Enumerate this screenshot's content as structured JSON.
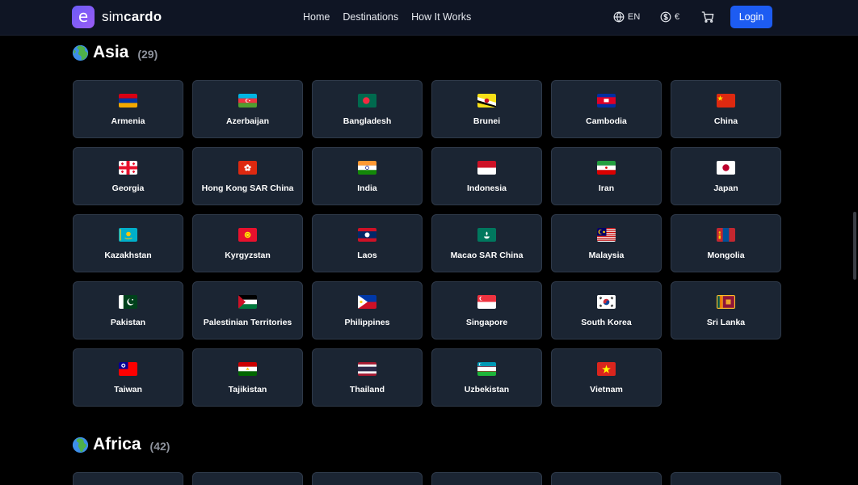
{
  "brand": {
    "logo_glyph": "e",
    "name_light": "sim",
    "name_bold": "cardo",
    "accent_color": "#7b5cf6"
  },
  "nav": {
    "items": [
      "Home",
      "Destinations",
      "How It Works"
    ]
  },
  "header": {
    "language": "EN",
    "currency": "€",
    "login_label": "Login",
    "login_color": "#1d5cf2"
  },
  "sections": [
    {
      "title": "Asia",
      "count": "(29)",
      "countries": [
        {
          "name": "Armenia",
          "flag": "am"
        },
        {
          "name": "Azerbaijan",
          "flag": "az"
        },
        {
          "name": "Bangladesh",
          "flag": "bd"
        },
        {
          "name": "Brunei",
          "flag": "bn"
        },
        {
          "name": "Cambodia",
          "flag": "kh"
        },
        {
          "name": "China",
          "flag": "cn"
        },
        {
          "name": "Georgia",
          "flag": "ge"
        },
        {
          "name": "Hong Kong SAR China",
          "flag": "hk"
        },
        {
          "name": "India",
          "flag": "in"
        },
        {
          "name": "Indonesia",
          "flag": "id"
        },
        {
          "name": "Iran",
          "flag": "ir"
        },
        {
          "name": "Japan",
          "flag": "jp"
        },
        {
          "name": "Kazakhstan",
          "flag": "kz"
        },
        {
          "name": "Kyrgyzstan",
          "flag": "kg"
        },
        {
          "name": "Laos",
          "flag": "la"
        },
        {
          "name": "Macao SAR China",
          "flag": "mo"
        },
        {
          "name": "Malaysia",
          "flag": "my"
        },
        {
          "name": "Mongolia",
          "flag": "mn"
        },
        {
          "name": "Pakistan",
          "flag": "pk"
        },
        {
          "name": "Palestinian Territories",
          "flag": "ps"
        },
        {
          "name": "Philippines",
          "flag": "ph"
        },
        {
          "name": "Singapore",
          "flag": "sg"
        },
        {
          "name": "South Korea",
          "flag": "kr"
        },
        {
          "name": "Sri Lanka",
          "flag": "lk"
        },
        {
          "name": "Taiwan",
          "flag": "tw"
        },
        {
          "name": "Tajikistan",
          "flag": "tj"
        },
        {
          "name": "Thailand",
          "flag": "th"
        },
        {
          "name": "Uzbekistan",
          "flag": "uz"
        },
        {
          "name": "Vietnam",
          "flag": "vn"
        }
      ]
    },
    {
      "title": "Africa",
      "count": "(42)",
      "countries": []
    }
  ]
}
